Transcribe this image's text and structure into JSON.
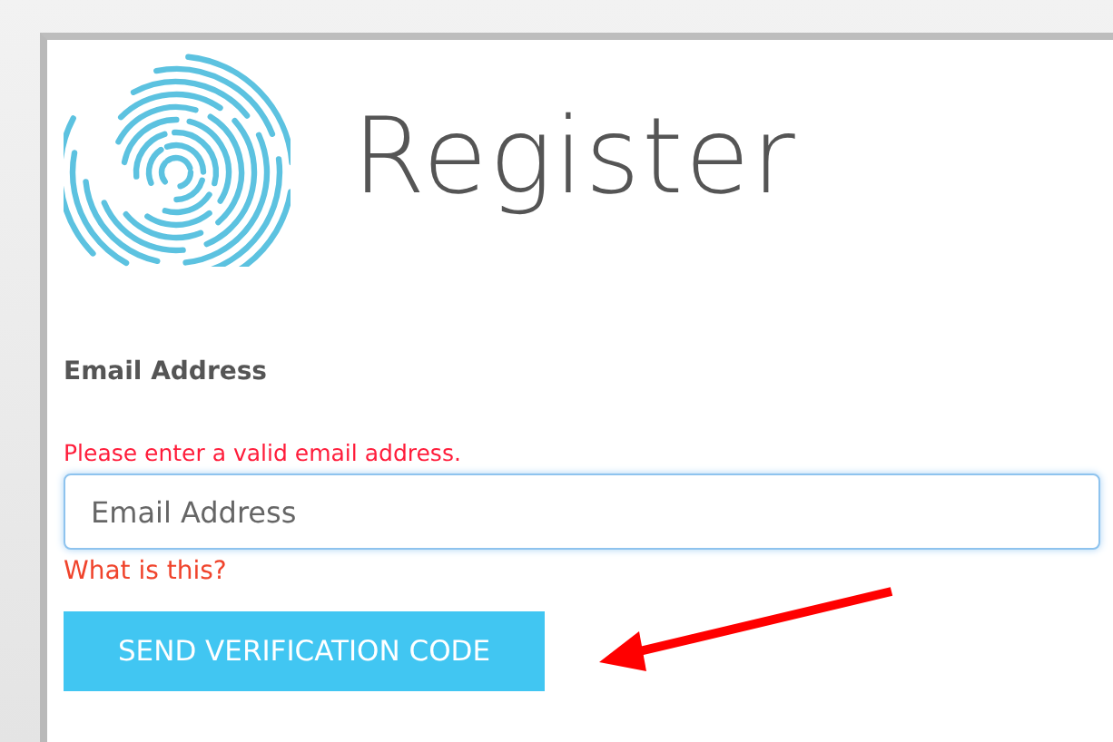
{
  "header": {
    "title": "Register"
  },
  "form": {
    "label": "Email Address",
    "error": "Please enter a valid email address.",
    "email_field": {
      "placeholder": "Email Address"
    },
    "help_link": "What is this?",
    "button": "SEND VERIFICATION CODE"
  },
  "annotation": {
    "kind": "arrow"
  }
}
